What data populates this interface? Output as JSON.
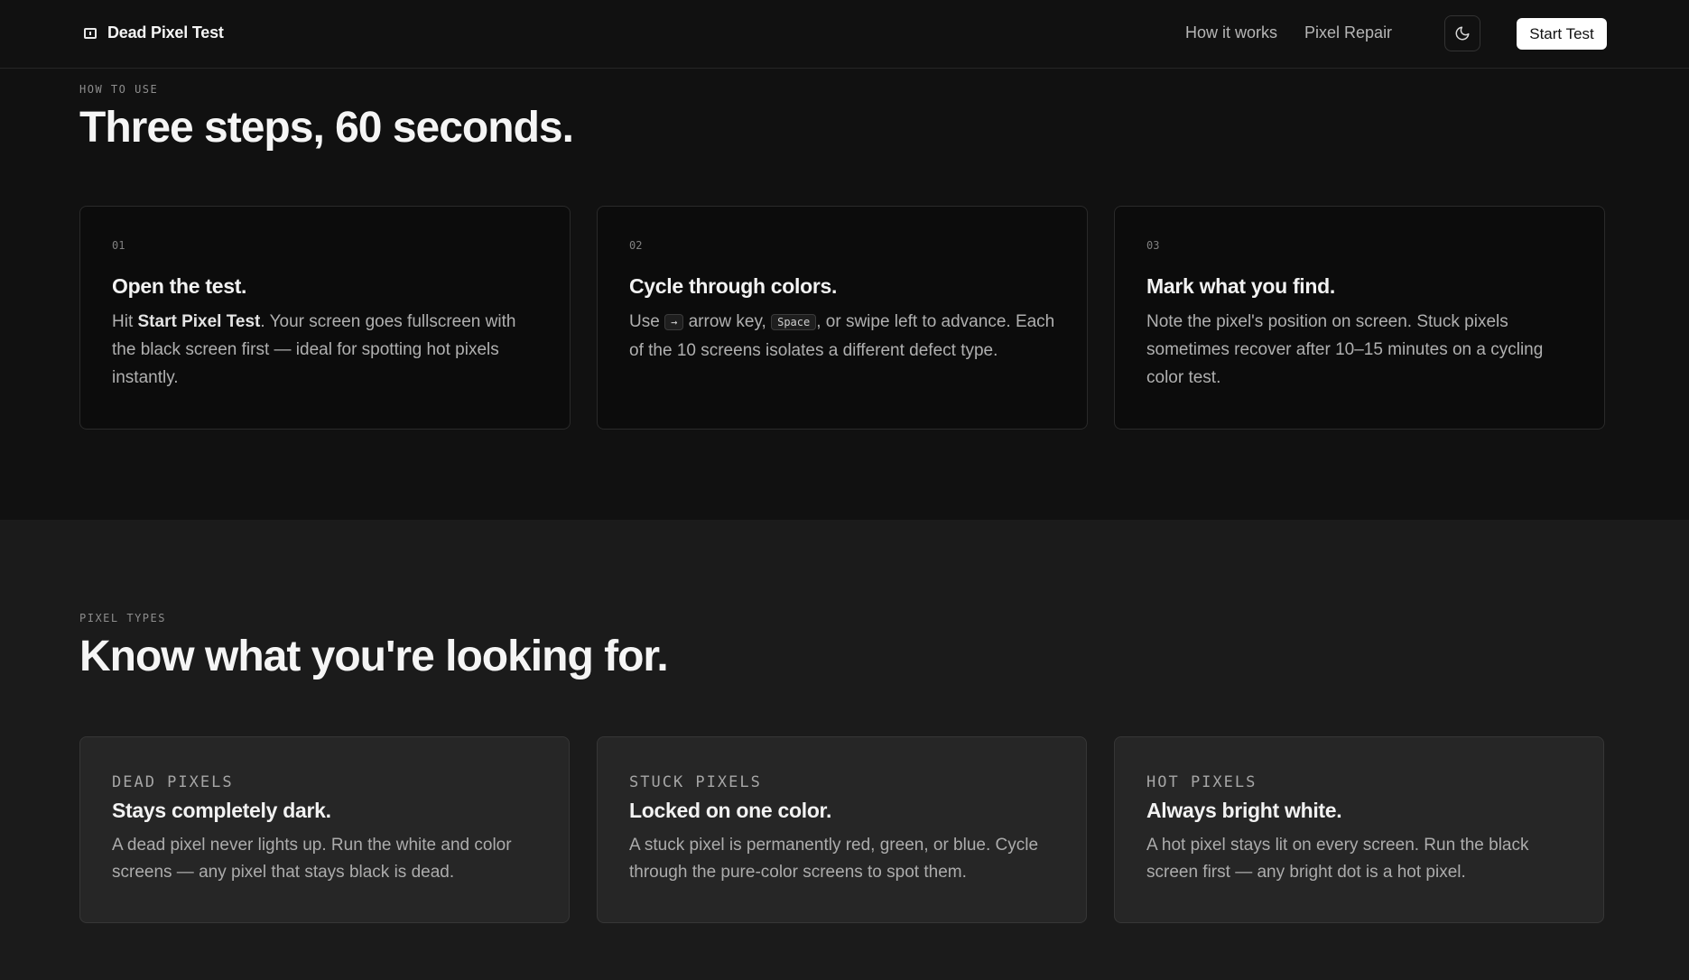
{
  "header": {
    "brand": "Dead Pixel Test",
    "nav": [
      "How it works",
      "Pixel Repair"
    ],
    "start_button": "Start Test"
  },
  "how_to_use": {
    "eyebrow": "HOW TO USE",
    "title": "Three steps, 60 seconds.",
    "steps": [
      {
        "num": "01",
        "title": "Open the test.",
        "text_before": "Hit ",
        "text_strong": "Start Pixel Test",
        "text_after": ". Your screen goes fullscreen with the black screen first — ideal for spotting hot pixels instantly."
      },
      {
        "num": "02",
        "title": "Cycle through colors.",
        "text_1": "Use ",
        "key_1": "→",
        "text_2": " arrow key, ",
        "key_2": "Space",
        "text_3": ", or swipe left to advance. Each of the 10 screens isolates a different defect type."
      },
      {
        "num": "03",
        "title": "Mark what you find.",
        "text": "Note the pixel's position on screen. Stuck pixels sometimes recover after 10–15 minutes on a cycling color test."
      }
    ]
  },
  "pixel_types": {
    "eyebrow": "PIXEL TYPES",
    "title": "Know what you're looking for.",
    "cards": [
      {
        "label": "DEAD PIXELS",
        "title": "Stays completely dark.",
        "text": "A dead pixel never lights up. Run the white and color screens — any pixel that stays black is dead."
      },
      {
        "label": "STUCK PIXELS",
        "title": "Locked on one color.",
        "text": "A stuck pixel is permanently red, green, or blue. Cycle through the pure-color screens to spot them."
      },
      {
        "label": "HOT PIXELS",
        "title": "Always bright white.",
        "text": "A hot pixel stays lit on every screen. Run the black screen first — any bright dot is a hot pixel."
      }
    ]
  }
}
